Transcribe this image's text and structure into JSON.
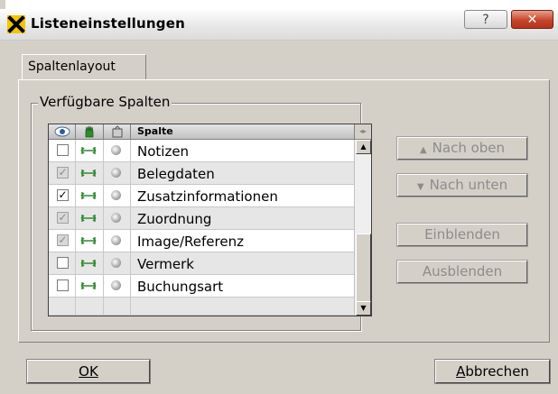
{
  "window": {
    "title": "Listeneinstellungen",
    "help_label": "?",
    "close_label": "✕"
  },
  "tabs": [
    {
      "label": "Spaltenlayout",
      "selected": true
    }
  ],
  "group": {
    "title": "Verfügbare Spalten"
  },
  "grid": {
    "column_header_label": "Spalte",
    "header_icons": [
      "visibility-eye-icon",
      "movable-hand-icon",
      "sort-icon"
    ],
    "rows": [
      {
        "visible": false,
        "disabled": false,
        "label": "Notizen"
      },
      {
        "visible": true,
        "disabled": true,
        "label": "Belegdaten"
      },
      {
        "visible": true,
        "disabled": false,
        "label": "Zusatzinformationen"
      },
      {
        "visible": true,
        "disabled": true,
        "label": "Zuordnung"
      },
      {
        "visible": true,
        "disabled": true,
        "label": "Image/Referenz"
      },
      {
        "visible": false,
        "disabled": false,
        "label": "Vermerk"
      },
      {
        "visible": false,
        "disabled": false,
        "label": "Buchungsart"
      }
    ]
  },
  "side_buttons": {
    "up_label": "Nach oben",
    "down_label": "Nach unten",
    "show_label": "Einblenden",
    "hide_label": "Ausblenden"
  },
  "dialog_buttons": {
    "ok_label": "OK",
    "cancel_first": "A",
    "cancel_rest": "bbrechen"
  },
  "colors": {
    "dialog_bg": "#d4d0c8",
    "close_red": "#c7452a",
    "disabled_text": "#8c8c8c"
  }
}
